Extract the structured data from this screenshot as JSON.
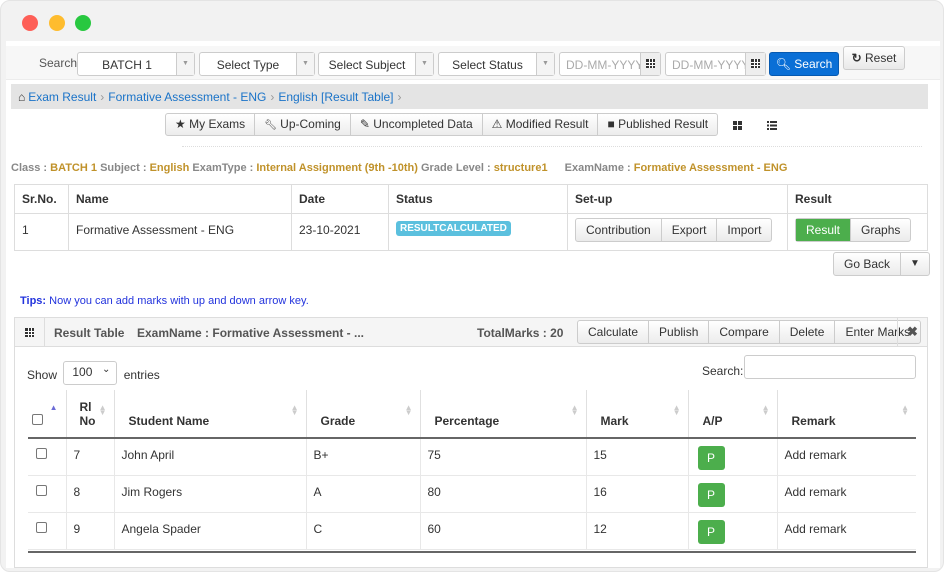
{
  "window": {
    "controls": [
      "close",
      "minimize",
      "maximize"
    ]
  },
  "search_bar": {
    "label": "Search",
    "batch": "BATCH 1",
    "type_placeholder": "Select Type",
    "subject_placeholder": "Select Subject",
    "status_placeholder": "Select Status",
    "from_date_placeholder": "DD-MM-YYYY",
    "to_date_placeholder": "DD-MM-YYYY",
    "search_button": "Search",
    "reset_button": "Reset"
  },
  "breadcrumb": [
    {
      "label": "Exam Result"
    },
    {
      "label": "Formative Assessment - ENG"
    },
    {
      "label": "English [Result Table]"
    }
  ],
  "tabs": [
    {
      "icon": "★",
      "label": "My Exams"
    },
    {
      "icon": "🔧",
      "label": "Up-Coming"
    },
    {
      "icon": "✎",
      "label": "Uncompleted Data"
    },
    {
      "icon": "⚠",
      "label": "Modified Result"
    },
    {
      "icon": "■",
      "label": "Published Result"
    }
  ],
  "info": {
    "class_label": "Class :",
    "class_value": "BATCH 1",
    "subject_label": "Subject :",
    "subject_value": "English",
    "examtype_label": "ExamType :",
    "examtype_value": "Internal Assignment (9th -10th)",
    "grade_label": "Grade Level :",
    "grade_value": "structure1",
    "examname_label": "ExamName :",
    "examname_value": "Formative Assessment - ENG"
  },
  "summary_table": {
    "headers": [
      "Sr.No.",
      "Name",
      "Date",
      "Status",
      "Set-up",
      "Result"
    ],
    "row": {
      "sr": "1",
      "name": "Formative Assessment - ENG",
      "date": "23-10-2021",
      "status": "RESULTCALCULATED",
      "setup_buttons": [
        "Contribution",
        "Export",
        "Import"
      ],
      "result_buttons": [
        "Result",
        "Graphs"
      ]
    }
  },
  "go_back": "Go Back",
  "tips": {
    "label": "Tips:",
    "text": " Now you can add marks with up and down arrow key."
  },
  "result_panel": {
    "title": "Result Table",
    "exam_name": "ExamName : Formative Assessment - ...",
    "total_marks": "TotalMarks : 20",
    "buttons": [
      "Calculate",
      "Publish",
      "Compare",
      "Delete",
      "Enter Marks"
    ],
    "show_label": "Show",
    "entries_value": "100",
    "entries_label": "entries",
    "search_label": "Search:",
    "columns": [
      "Rl No",
      "Student Name",
      "Grade",
      "Percentage",
      "Mark",
      "A/P",
      "Remark"
    ],
    "rows": [
      {
        "rl": "7",
        "name": "John April",
        "grade": "B+",
        "percentage": "75",
        "mark": "15",
        "ap": "P",
        "remark": "Add remark"
      },
      {
        "rl": "8",
        "name": "Jim Rogers",
        "grade": "A",
        "percentage": "80",
        "mark": "16",
        "ap": "P",
        "remark": "Add remark"
      },
      {
        "rl": "9",
        "name": "Angela Spader",
        "grade": "C",
        "percentage": "60",
        "mark": "12",
        "ap": "P",
        "remark": "Add remark"
      }
    ]
  },
  "colors": {
    "primary": "#0a6fd6",
    "success": "#4cae4c",
    "info": "#5bc0de",
    "accent": "#c0922a",
    "link": "#1a73c8"
  }
}
